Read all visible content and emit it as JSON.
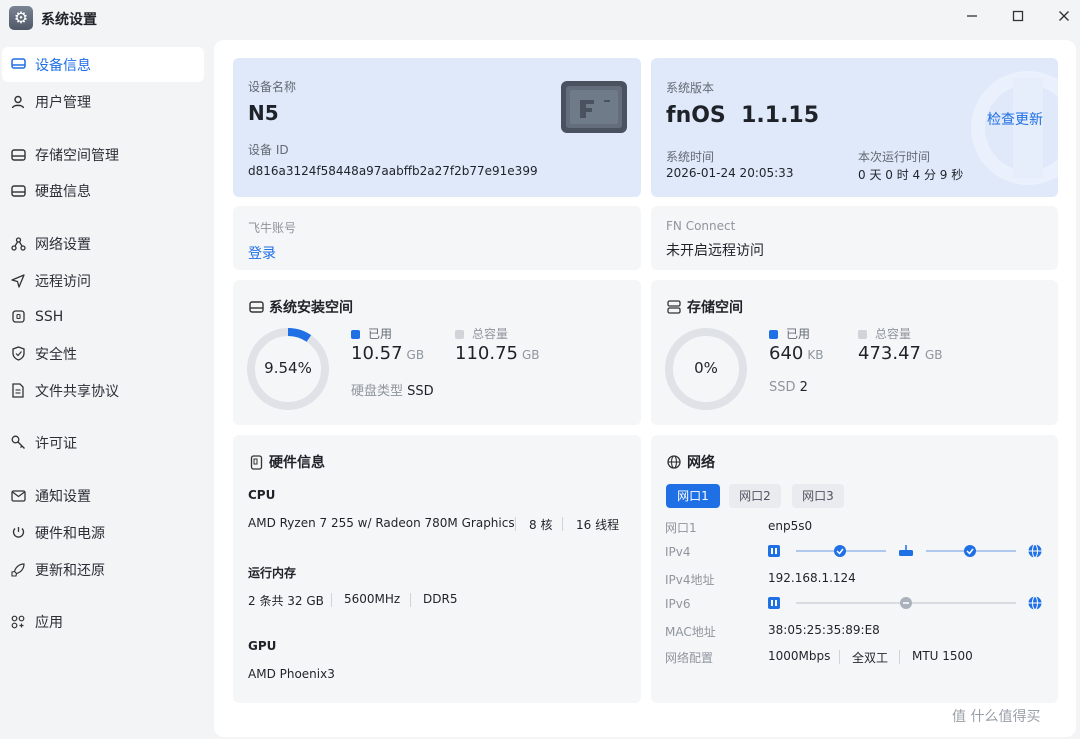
{
  "window": {
    "title": "系统设置",
    "icon": "gear-icon"
  },
  "sidebar": {
    "items": [
      {
        "label": "设备信息",
        "icon": "monitor-icon",
        "active": true
      },
      {
        "label": "用户管理",
        "icon": "user-icon"
      },
      {
        "label": "存储空间管理",
        "icon": "storage-icon"
      },
      {
        "label": "硬盘信息",
        "icon": "disk-icon"
      },
      {
        "label": "网络设置",
        "icon": "network-icon"
      },
      {
        "label": "远程访问",
        "icon": "send-icon"
      },
      {
        "label": "SSH",
        "icon": "ssh-icon"
      },
      {
        "label": "安全性",
        "icon": "shield-icon"
      },
      {
        "label": "文件共享协议",
        "icon": "file-icon"
      },
      {
        "label": "许可证",
        "icon": "key-icon"
      },
      {
        "label": "通知设置",
        "icon": "mail-icon"
      },
      {
        "label": "硬件和电源",
        "icon": "power-icon"
      },
      {
        "label": "更新和还原",
        "icon": "rocket-icon"
      },
      {
        "label": "应用",
        "icon": "apps-icon"
      }
    ]
  },
  "device": {
    "name_label": "设备名称",
    "name": "N5",
    "id_label": "设备 ID",
    "id": "d816a3124f58448a97aabffb2a27f2b77e91e399"
  },
  "system": {
    "version_label": "系统版本",
    "version": "fnOS  1.1.15",
    "check_update": "检查更新",
    "time_label": "系统时间",
    "time": "2026-01-24 20:05:33",
    "uptime_label": "本次运行时间",
    "uptime": "0 天 0 时 4 分 9 秒"
  },
  "account": {
    "label": "飞牛账号",
    "login": "登录"
  },
  "connect": {
    "label": "FN Connect",
    "status": "未开启远程访问"
  },
  "system_space": {
    "title": "系统安装空间",
    "percent_text": "9.54%",
    "percent": 0.0954,
    "used_label": "已用",
    "used_value": "10.57",
    "used_unit": "GB",
    "total_label": "总容量",
    "total_value": "110.75",
    "total_unit": "GB",
    "disk_type_label": "硬盘类型",
    "disk_type": "SSD",
    "used_color": "#1f6fe5",
    "total_color": "#d0d3d8"
  },
  "storage": {
    "title": "存储空间",
    "percent_text": "0%",
    "percent": 0,
    "used_label": "已用",
    "used_value": "640",
    "used_unit": "KB",
    "total_label": "总容量",
    "total_value": "473.47",
    "total_unit": "GB",
    "ssd_label": "SSD",
    "ssd_count": "2"
  },
  "hardware": {
    "title": "硬件信息",
    "cpu_label": "CPU",
    "cpu_model": "AMD Ryzen 7 255 w/ Radeon 780M Graphics",
    "cpu_cores": "8 核",
    "cpu_threads": "16 线程",
    "mem_label": "运行内存",
    "mem_size": "2 条共 32 GB",
    "mem_speed": "5600MHz",
    "mem_type": "DDR5",
    "gpu_label": "GPU",
    "gpu_model": "AMD Phoenix3"
  },
  "network": {
    "title": "网络",
    "tabs": [
      "网口1",
      "网口2",
      "网口3"
    ],
    "port_label": "网口1",
    "port_value": "enp5s0",
    "ipv4_label": "IPv4",
    "ipv4_addr_label": "IPv4地址",
    "ipv4_addr": "192.168.1.124",
    "ipv6_label": "IPv6",
    "mac_label": "MAC地址",
    "mac": "38:05:25:35:89:E8",
    "config_label": "网络配置",
    "speed": "1000Mbps",
    "duplex": "全双工",
    "mtu": "MTU 1500",
    "accent": "#1f6fe5"
  },
  "watermark": "值 什么值得买"
}
